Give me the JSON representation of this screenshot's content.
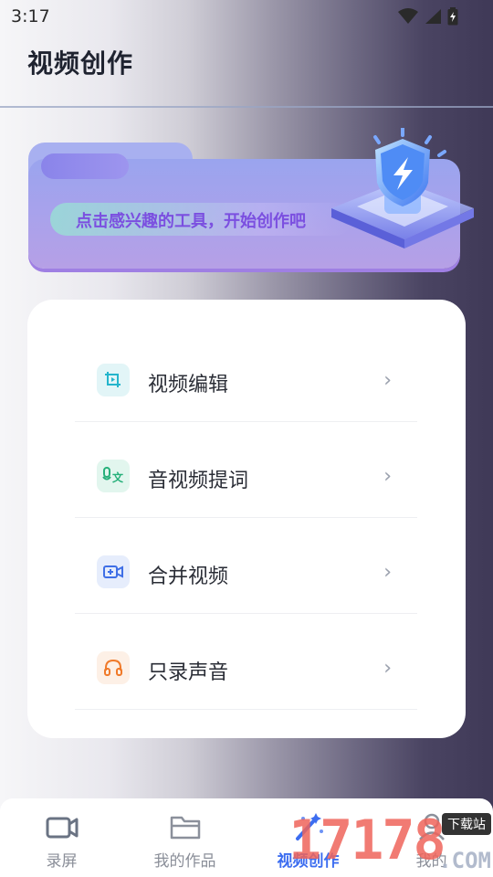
{
  "status": {
    "time": "3:17"
  },
  "header": {
    "title": "视频创作"
  },
  "banner": {
    "text": "点击感兴趣的工具，开始创作吧"
  },
  "menu": [
    {
      "label": "视频编辑",
      "icon": "crop-video-icon",
      "color": "#24b5cc"
    },
    {
      "label": "音视频提词",
      "icon": "audio-text-icon",
      "color": "#26b07a"
    },
    {
      "label": "合并视频",
      "icon": "merge-video-icon",
      "color": "#3f6fe6"
    },
    {
      "label": "只录声音",
      "icon": "headphones-icon",
      "color": "#f07a2a"
    }
  ],
  "nav": [
    {
      "label": "录屏",
      "icon": "camera-icon"
    },
    {
      "label": "我的作品",
      "icon": "folder-icon"
    },
    {
      "label": "视频创作",
      "icon": "magic-wand-icon",
      "active": true
    },
    {
      "label": "我的",
      "icon": "user-icon"
    }
  ],
  "watermark": {
    "number": "17178",
    "badge": "下载站",
    "domain": ".COM"
  },
  "colors": {
    "accent": "#3c6df0",
    "banner_text": "#7b4fe0"
  }
}
